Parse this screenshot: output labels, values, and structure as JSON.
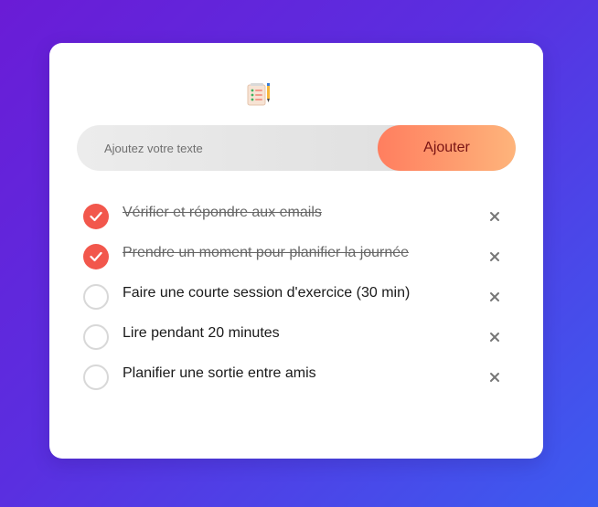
{
  "header": {
    "icon": "notepad-checklist-icon"
  },
  "input": {
    "placeholder": "Ajoutez votre texte",
    "value": ""
  },
  "add_button": {
    "label": "Ajouter"
  },
  "colors": {
    "accent": "#f2574c",
    "button_gradient_start": "#ff7e5f",
    "button_gradient_end": "#feb47b",
    "background_gradient_start": "#6a1cd6",
    "background_gradient_end": "#3c5cf0"
  },
  "tasks": [
    {
      "text": "Vérifier et répondre aux emails",
      "done": true
    },
    {
      "text": "Prendre un moment pour planifier la journée",
      "done": true
    },
    {
      "text": "Faire une courte session d'exercice (30 min)",
      "done": false
    },
    {
      "text": "Lire pendant 20 minutes",
      "done": false
    },
    {
      "text": "Planifier une sortie entre amis",
      "done": false
    }
  ]
}
